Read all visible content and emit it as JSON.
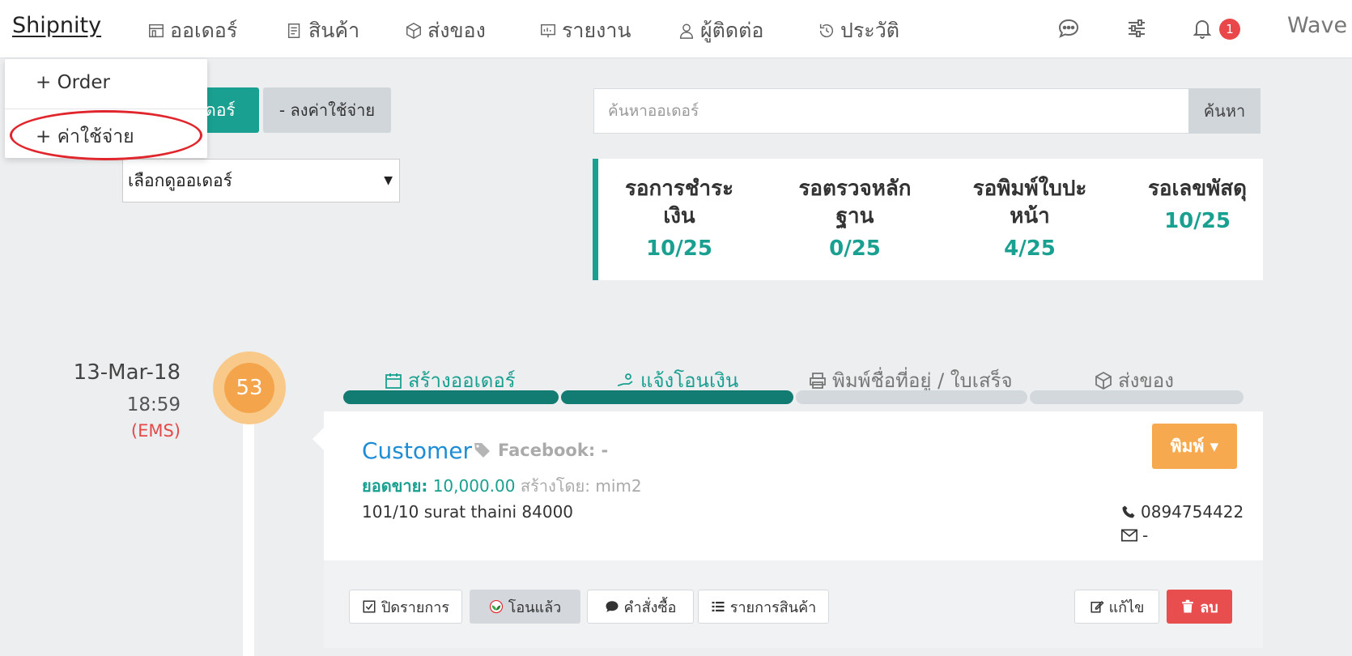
{
  "nav": {
    "brand": "Shipnity",
    "items": [
      "ออเดอร์",
      "สินค้า",
      "ส่งของ",
      "รายงาน",
      "ผู้ติดต่อ",
      "ประวัติ"
    ],
    "notification_count": "1",
    "user": "Wave ▾"
  },
  "menu": {
    "order": "+ Order",
    "expense": "+ ค่าใช้จ่าย"
  },
  "actions": {
    "add_order": "เดอร์",
    "subtract_expense": "- ลงค่าใช้จ่าย",
    "view_select": "เลือกดูออเดอร์"
  },
  "search": {
    "placeholder": "ค้นหาออเดอร์",
    "button": "ค้นหา"
  },
  "stats": [
    {
      "label_1": "รอการชำระ",
      "label_2": "เงิน",
      "value": "10/25"
    },
    {
      "label_1": "รอตรวจหลัก",
      "label_2": "ฐาน",
      "value": "0/25"
    },
    {
      "label_1": "รอพิมพ์ใบปะ",
      "label_2": "หน้า",
      "value": "4/25"
    },
    {
      "label_1": "รอเลขพัสดุ",
      "label_2": "",
      "value": "10/25"
    }
  ],
  "order": {
    "date": "13-Mar-18",
    "time": "18:59",
    "shipping": "(EMS)",
    "number": "53",
    "steps": [
      "สร้างออเดอร์",
      "แจ้งโอนเงิน",
      "พิมพ์ชื่อที่อยู่ / ใบเสร็จ",
      "ส่งของ"
    ],
    "progress_complete": 2,
    "customer": "Customer",
    "facebook": "Facebook: -",
    "sales_label": "ยอดขาย:",
    "sales_value": "10,000.00",
    "created_by": "สร้างโดย: mim2",
    "address": "101/10 surat thaini 84000",
    "phone": "0894754422",
    "email": "-",
    "print_label": "พิมพ์ ▾",
    "buttons": [
      "ปิดรายการ",
      "โอนแล้ว",
      "คำสั่งซื้อ",
      "รายการสินค้า",
      "แก้ไข",
      "ลบ"
    ]
  },
  "colors": {
    "accent": "#1aa090",
    "link": "#1f8dd6",
    "warning": "#f7a94f",
    "danger": "#e94e4e"
  }
}
